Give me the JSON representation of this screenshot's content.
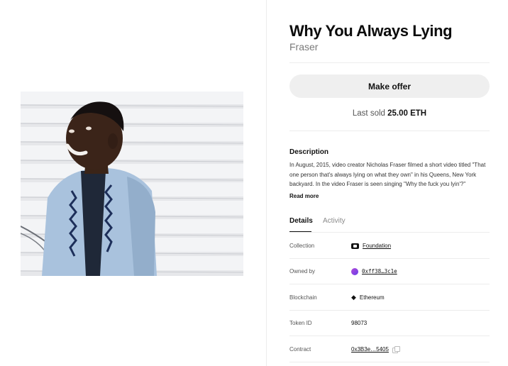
{
  "nft": {
    "title": "Why You Always Lying",
    "creator": "Fraser"
  },
  "actions": {
    "make_offer_label": "Make offer"
  },
  "sale": {
    "last_sold_label": "Last sold",
    "last_sold_value": "25.00 ETH"
  },
  "description": {
    "heading": "Description",
    "text": "In August, 2015, video creator Nicholas Fraser filmed a short video titled \"That one person that's always lying on what they own\" in his Queens, New York backyard. In the video Fraser is seen singing \"Why the fuck you lyin'?\"",
    "read_more_label": "Read more"
  },
  "tabs": [
    {
      "label": "Details",
      "active": true
    },
    {
      "label": "Activity",
      "active": false
    }
  ],
  "details": {
    "collection_label": "Collection",
    "collection_value": "Foundation",
    "owned_by_label": "Owned by",
    "owned_by_value": "0xff38…3c1e",
    "blockchain_label": "Blockchain",
    "blockchain_value": "Ethereum",
    "token_id_label": "Token ID",
    "token_id_value": "98073",
    "contract_label": "Contract",
    "contract_value": "0x3B3e…5405"
  },
  "icons": {
    "collection": "foundation-logo-icon",
    "owner": "avatar-icon",
    "blockchain": "ethereum-icon",
    "copy": "copy-icon"
  },
  "colors": {
    "button_bg": "#efefef",
    "divider": "#ececec",
    "avatar_gradient_start": "#b14bd9",
    "avatar_gradient_end": "#6a3ee8"
  }
}
